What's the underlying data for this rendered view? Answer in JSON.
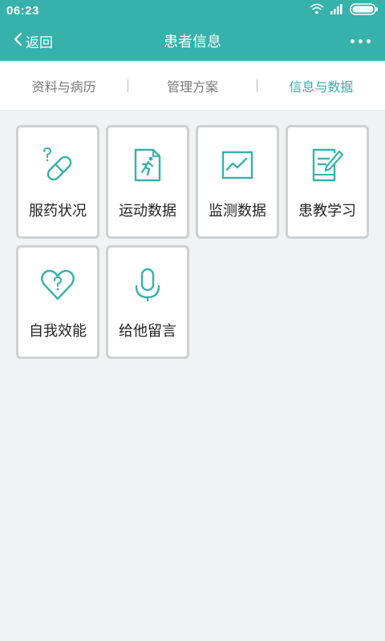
{
  "status_bar": {
    "time": "06:23",
    "icons": [
      "wifi-icon",
      "signal-icon",
      "battery-icon"
    ]
  },
  "navbar": {
    "back_label": "返回",
    "title": "患者信息",
    "more_icon": "more-dots-icon"
  },
  "tabs": [
    {
      "label": "资料与病历",
      "active": false
    },
    {
      "label": "管理方案",
      "active": false
    },
    {
      "label": "信息与数据",
      "active": true
    }
  ],
  "tiles": [
    {
      "label": "服药状况",
      "icon": "pill-icon"
    },
    {
      "label": "运动数据",
      "icon": "running-icon"
    },
    {
      "label": "监测数据",
      "icon": "chart-icon"
    },
    {
      "label": "患教学习",
      "icon": "notebook-pen-icon"
    },
    {
      "label": "自我效能",
      "icon": "heart-question-icon"
    },
    {
      "label": "给他留言",
      "icon": "microphone-icon"
    }
  ],
  "colors": {
    "accent": "#36b2aa",
    "background": "#f1f2f4",
    "tile_border": "#cfd0d2"
  }
}
